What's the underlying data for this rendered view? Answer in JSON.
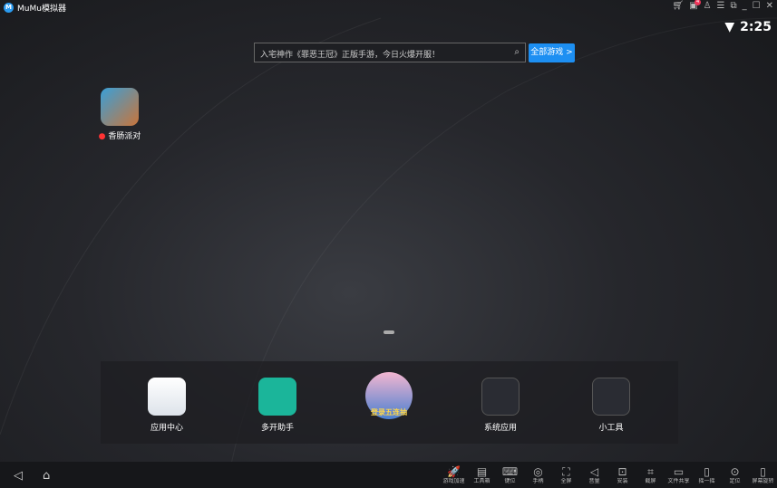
{
  "window": {
    "title": "MuMu模拟器",
    "notification_count": "4"
  },
  "status": {
    "time": "2:25"
  },
  "search": {
    "placeholder": "入宅神作《罪恶王冠》正版手游，今日火爆开服！",
    "all_games": "全部游戏 >"
  },
  "desktop": {
    "apps": [
      {
        "label": "香肠派对",
        "new": true
      }
    ]
  },
  "dock": [
    {
      "label": "应用中心"
    },
    {
      "label": "多开助手"
    },
    {
      "label": "",
      "banner": "登录五连抽"
    },
    {
      "label": "系统应用"
    },
    {
      "label": "小工具"
    }
  ],
  "toolbar": [
    {
      "label": "游戏加速",
      "icon": "rocket-icon",
      "glyph": "🚀"
    },
    {
      "label": "工具箱",
      "icon": "toolbox-icon",
      "glyph": "▤"
    },
    {
      "label": "键位",
      "icon": "keyboard-icon",
      "glyph": "⌨"
    },
    {
      "label": "手柄",
      "icon": "gamepad-icon",
      "glyph": "◎"
    },
    {
      "label": "全屏",
      "icon": "fullscreen-icon",
      "glyph": "⛶"
    },
    {
      "label": "音量",
      "icon": "volume-icon",
      "glyph": "◁"
    },
    {
      "label": "安装",
      "icon": "apk-icon",
      "glyph": "⊡"
    },
    {
      "label": "截屏",
      "icon": "crop-icon",
      "glyph": "⌗"
    },
    {
      "label": "文件共享",
      "icon": "folder-icon",
      "glyph": "▭"
    },
    {
      "label": "摇一摇",
      "icon": "shake-icon",
      "glyph": "▯"
    },
    {
      "label": "定位",
      "icon": "location-icon",
      "glyph": "⊙"
    },
    {
      "label": "屏幕旋转",
      "icon": "rotate-icon",
      "glyph": "▯"
    }
  ],
  "colors": {
    "accent": "#1d8ff2",
    "badge": "#f0355a"
  }
}
